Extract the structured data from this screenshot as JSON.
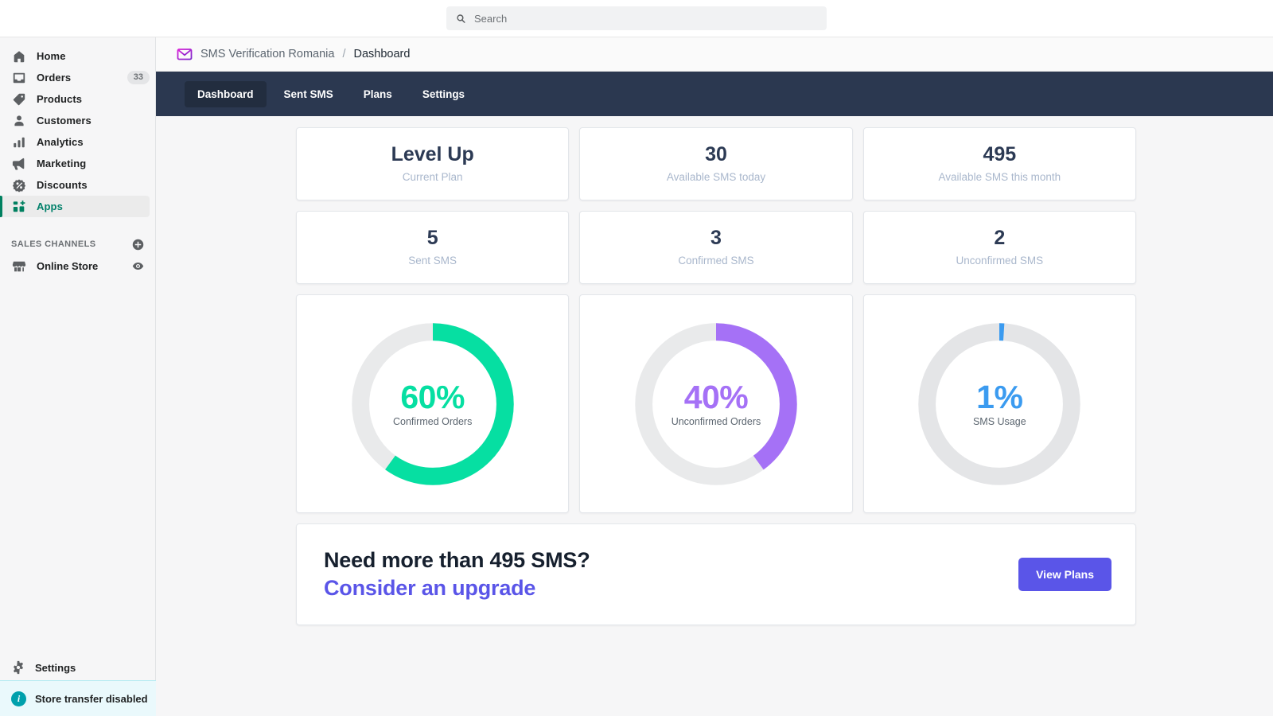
{
  "search": {
    "placeholder": "Search",
    "value": "",
    "icon": "search-icon"
  },
  "sidebar": {
    "items": [
      {
        "label": "Home",
        "icon": "home-icon",
        "badge": "",
        "active": false
      },
      {
        "label": "Orders",
        "icon": "orders-inbox-icon",
        "badge": "33",
        "active": false
      },
      {
        "label": "Products",
        "icon": "tag-icon",
        "badge": "",
        "active": false
      },
      {
        "label": "Customers",
        "icon": "person-icon",
        "badge": "",
        "active": false
      },
      {
        "label": "Analytics",
        "icon": "bar-chart-icon",
        "badge": "",
        "active": false
      },
      {
        "label": "Marketing",
        "icon": "megaphone-icon",
        "badge": "",
        "active": false
      },
      {
        "label": "Discounts",
        "icon": "discount-percent-icon",
        "badge": "",
        "active": false
      },
      {
        "label": "Apps",
        "icon": "apps-grid-plus-icon",
        "badge": "",
        "active": true
      }
    ],
    "sales_channels": {
      "title": "SALES CHANNELS",
      "add_icon": "plus-circle-icon",
      "channels": [
        {
          "label": "Online Store",
          "icon": "storefront-icon",
          "action_icon": "eye-icon"
        }
      ]
    },
    "settings": {
      "label": "Settings",
      "icon": "gear-icon"
    },
    "transfer_banner": {
      "label": "Store transfer disabled",
      "icon": "info-icon"
    },
    "accent_color": "#008060"
  },
  "breadcrumb": {
    "logo_icon": "envelope-logo-icon",
    "shop": "SMS Verification Romania",
    "separator": "/",
    "page": "Dashboard"
  },
  "tabs": [
    {
      "label": "Dashboard",
      "active": true
    },
    {
      "label": "Sent SMS",
      "active": false
    },
    {
      "label": "Plans",
      "active": false
    },
    {
      "label": "Settings",
      "active": false
    }
  ],
  "stats_row_1": [
    {
      "value": "Level Up",
      "label": "Current Plan"
    },
    {
      "value": "30",
      "label": "Available SMS today"
    },
    {
      "value": "495",
      "label": "Available SMS this month"
    }
  ],
  "stats_row_2": [
    {
      "value": "5",
      "label": "Sent SMS"
    },
    {
      "value": "3",
      "label": "Confirmed SMS"
    },
    {
      "value": "2",
      "label": "Unconfirmed SMS"
    }
  ],
  "chart_data": [
    {
      "type": "pie",
      "title": "Confirmed Orders",
      "percent_label": "60%",
      "values": [
        60,
        40
      ],
      "categories": [
        "Confirmed Orders",
        "Remaining"
      ],
      "color": "#06dfa2",
      "track_color": "#e9eaeb"
    },
    {
      "type": "pie",
      "title": "Unconfirmed Orders",
      "percent_label": "40%",
      "values": [
        40,
        60
      ],
      "categories": [
        "Unconfirmed Orders",
        "Remaining"
      ],
      "color": "#a571f6",
      "track_color": "#e9eaeb"
    },
    {
      "type": "pie",
      "title": "SMS Usage",
      "percent_label": "1%",
      "values": [
        1,
        99
      ],
      "categories": [
        "SMS Usage",
        "Remaining"
      ],
      "color": "#3b9bf0",
      "track_color": "#e4e5e7"
    }
  ],
  "banner": {
    "line1": "Need more than 495 SMS?",
    "line2": "Consider an upgrade",
    "button_label": "View Plans",
    "button_color": "#5a55e8"
  }
}
